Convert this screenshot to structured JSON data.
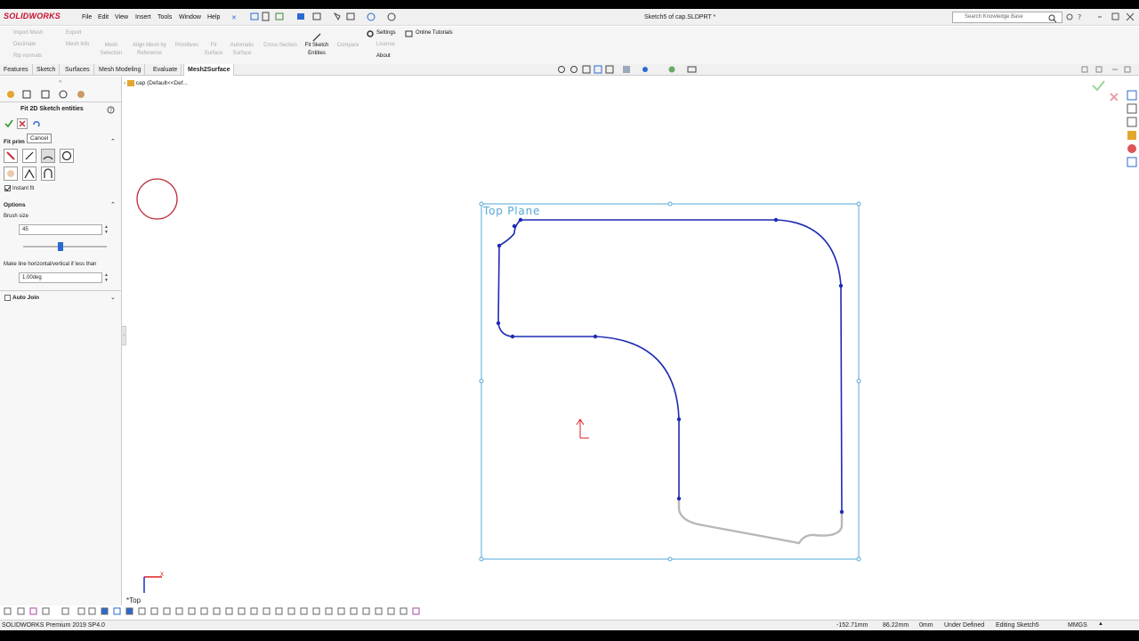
{
  "app": {
    "logo_text": "SOLIDWORKS",
    "document_title": "Sketch5 of cap.SLDPRT *",
    "search_placeholder": "Search Knowledge Base"
  },
  "menu": [
    "File",
    "Edit",
    "View",
    "Insert",
    "Tools",
    "Window",
    "Help"
  ],
  "ribbon": {
    "small_buttons": [
      "Import Mesh",
      "Export",
      "Decimate",
      "Mesh Info",
      "Rip normals"
    ],
    "buttons": [
      {
        "label": "Mesh Selection",
        "enabled": false
      },
      {
        "label": "Align Mesh by Reference",
        "enabled": false
      },
      {
        "label": "Primitives",
        "enabled": false
      },
      {
        "label": "Fit Surface",
        "enabled": false
      },
      {
        "label": "Automatic Surface",
        "enabled": false
      },
      {
        "label": "Cross-Section",
        "enabled": false
      },
      {
        "label": "Fit Sketch Entities",
        "enabled": true
      },
      {
        "label": "Compare",
        "enabled": false
      }
    ],
    "links": [
      "Settings",
      "License",
      "About"
    ],
    "online_tutorials": "Online Tutorials"
  },
  "tabs": [
    "Features",
    "Sketch",
    "Surfaces",
    "Mesh Modeling",
    "Evaluate",
    "Mesh2Surface"
  ],
  "active_tab": "Mesh2Surface",
  "panel": {
    "title": "Fit 2D Sketch entities",
    "tooltip": "Cancel",
    "fit_primitives_label": "Fit prim",
    "instant_fit_label": "Instant fit",
    "options_label": "Options",
    "brush_size_label": "Brush size",
    "brush_size_value": "45",
    "brush_slider_fraction": 0.5,
    "make_line_label": "Make line horizontal/vertical if less than",
    "angle_value": "1.00deg",
    "auto_join_label": "Auto Join"
  },
  "feature_tree": {
    "item": "cap (Default<<Def..."
  },
  "viewport": {
    "plane_label": "Top Plane",
    "view_label": "*Top"
  },
  "status": {
    "product": "SOLIDWORKS Premium 2019 SP4.0",
    "x": "-152.71mm",
    "y": "86.22mm",
    "z": "0mm",
    "state": "Under Defined",
    "editing": "Editing Sketch5",
    "units": "MMGS"
  },
  "colors": {
    "brand_red": "#c8102e",
    "sketch_blue": "#1d2bb3",
    "plane_blue": "#55a8d8",
    "mesh_gray": "#b8b8b8",
    "brush_red": "#c0303a"
  }
}
